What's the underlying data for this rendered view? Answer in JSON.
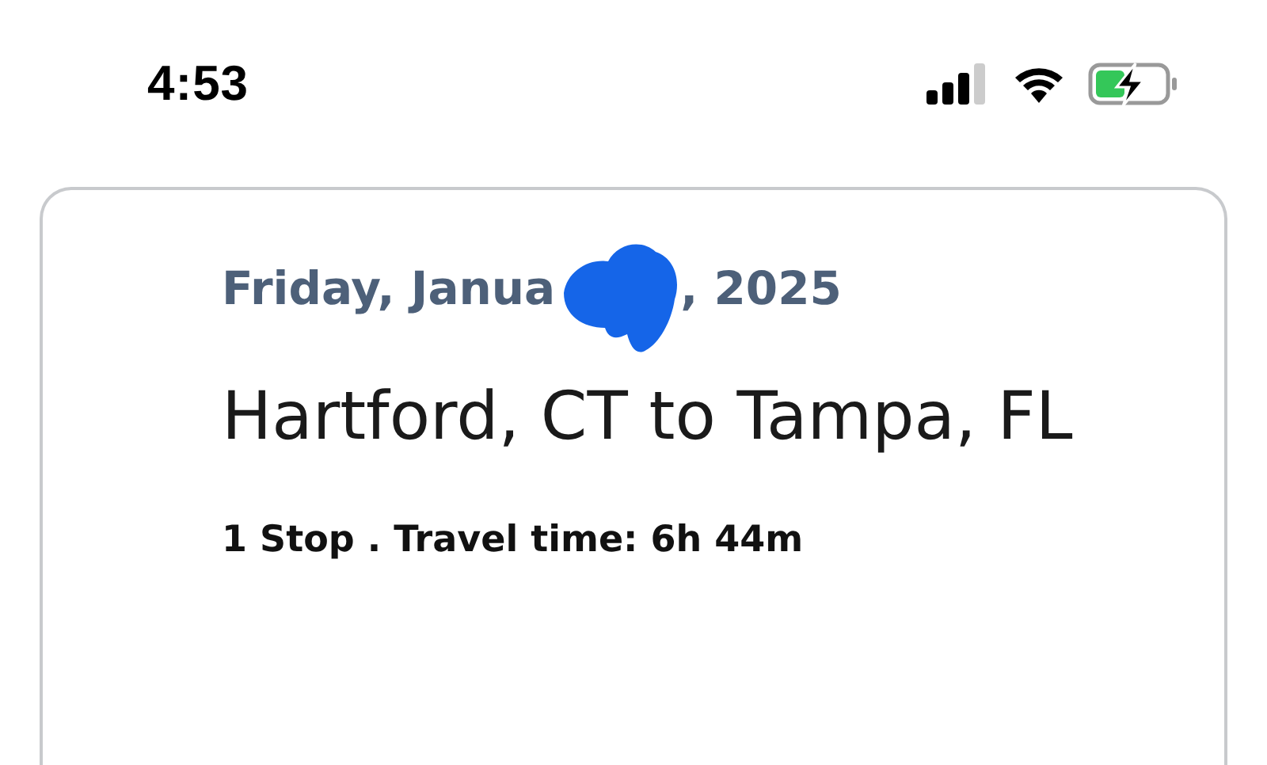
{
  "status_bar": {
    "time": "4:53"
  },
  "trip": {
    "date_parts": [
      "Friday, Janua",
      ", 2025"
    ],
    "route": "Hartford, CT to Tampa, FL",
    "summary": "1 Stop . Travel time: 6h 44m"
  }
}
